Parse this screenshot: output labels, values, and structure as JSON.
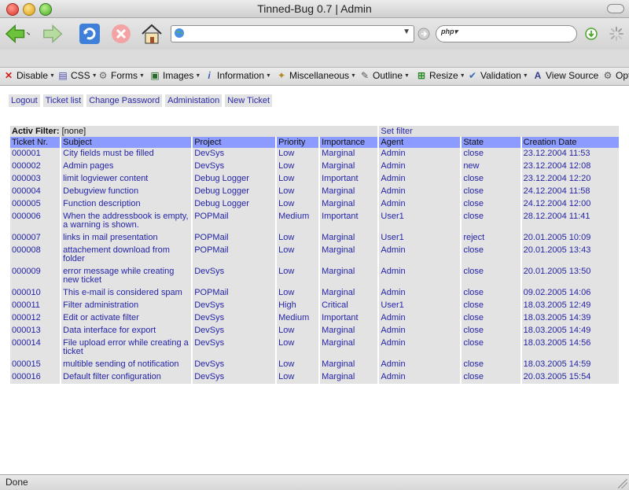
{
  "window": {
    "title": "Tinned-Bug 0.7 | Admin"
  },
  "navbar": {
    "url_value": "",
    "search_value": "",
    "search_engine_label": "php"
  },
  "devbar": {
    "items": [
      {
        "label": "Disable"
      },
      {
        "label": "CSS"
      },
      {
        "label": "Forms"
      },
      {
        "label": "Images"
      },
      {
        "label": "Information"
      },
      {
        "label": "Miscellaneous"
      },
      {
        "label": "Outline"
      },
      {
        "label": "Resize"
      },
      {
        "label": "Validation"
      },
      {
        "label": "View Source"
      },
      {
        "label": "Opt"
      }
    ]
  },
  "links": [
    {
      "label": "Logout"
    },
    {
      "label": "Ticket list"
    },
    {
      "label": "Change Password"
    },
    {
      "label": "Administation"
    },
    {
      "label": "New Ticket"
    }
  ],
  "filter": {
    "label": "Activ Filter:",
    "value": "[none]",
    "set_label": "Set filter"
  },
  "table": {
    "headers": [
      "Ticket Nr.",
      "Subject",
      "Project",
      "Priority",
      "Importance",
      "Agent",
      "State",
      "Creation Date"
    ],
    "rows": [
      [
        "000001",
        "City fields must be filled",
        "DevSys",
        "Low",
        "Marginal",
        "Admin",
        "close",
        "23.12.2004 11:53"
      ],
      [
        "000002",
        "Admin pages",
        "DevSys",
        "Low",
        "Marginal",
        "Admin",
        "new",
        "23.12.2004 12:08"
      ],
      [
        "000003",
        "limit logviewer content",
        "Debug Logger",
        "Low",
        "Important",
        "Admin",
        "close",
        "23.12.2004 12:20"
      ],
      [
        "000004",
        "Debugview function",
        "Debug Logger",
        "Low",
        "Marginal",
        "Admin",
        "close",
        "24.12.2004 11:58"
      ],
      [
        "000005",
        "Function description",
        "Debug Logger",
        "Low",
        "Marginal",
        "Admin",
        "close",
        "24.12.2004 12:00"
      ],
      [
        "000006",
        "When the addressbook is empty, a warning is shown.",
        "POPMail",
        "Medium",
        "Important",
        "User1",
        "close",
        "28.12.2004 11:41"
      ],
      [
        "000007",
        "links in mail presentation",
        "POPMail",
        "Low",
        "Marginal",
        "User1",
        "reject",
        "20.01.2005 10:09"
      ],
      [
        "000008",
        "attachement download from folder",
        "POPMail",
        "Low",
        "Marginal",
        "Admin",
        "close",
        "20.01.2005 13:43"
      ],
      [
        "000009",
        "error message while creating new ticket",
        "DevSys",
        "Low",
        "Marginal",
        "Admin",
        "close",
        "20.01.2005 13:50"
      ],
      [
        "000010",
        "This e-mail is considered spam",
        "POPMail",
        "Low",
        "Marginal",
        "Admin",
        "close",
        "09.02.2005 14:06"
      ],
      [
        "000011",
        "Filter administration",
        "DevSys",
        "High",
        "Critical",
        "User1",
        "close",
        "18.03.2005 12:49"
      ],
      [
        "000012",
        "Edit or activate filter",
        "DevSys",
        "Medium",
        "Important",
        "Admin",
        "close",
        "18.03.2005 14:39"
      ],
      [
        "000013",
        "Data interface for export",
        "DevSys",
        "Low",
        "Marginal",
        "Admin",
        "close",
        "18.03.2005 14:49"
      ],
      [
        "000014",
        "File upload error while creating a ticket",
        "DevSys",
        "Low",
        "Marginal",
        "Admin",
        "close",
        "18.03.2005 14:56"
      ],
      [
        "000015",
        "multible sending of notification",
        "DevSys",
        "Low",
        "Marginal",
        "Admin",
        "close",
        "18.03.2005 14:59"
      ],
      [
        "000016",
        "Default filter configuration",
        "DevSys",
        "Low",
        "Marginal",
        "Admin",
        "close",
        "20.03.2005 15:54"
      ]
    ]
  },
  "status": {
    "text": "Done"
  },
  "colors": {
    "header_bg": "#8c9bff",
    "cell_bg": "#e3e3e3",
    "link": "#2424a8"
  }
}
